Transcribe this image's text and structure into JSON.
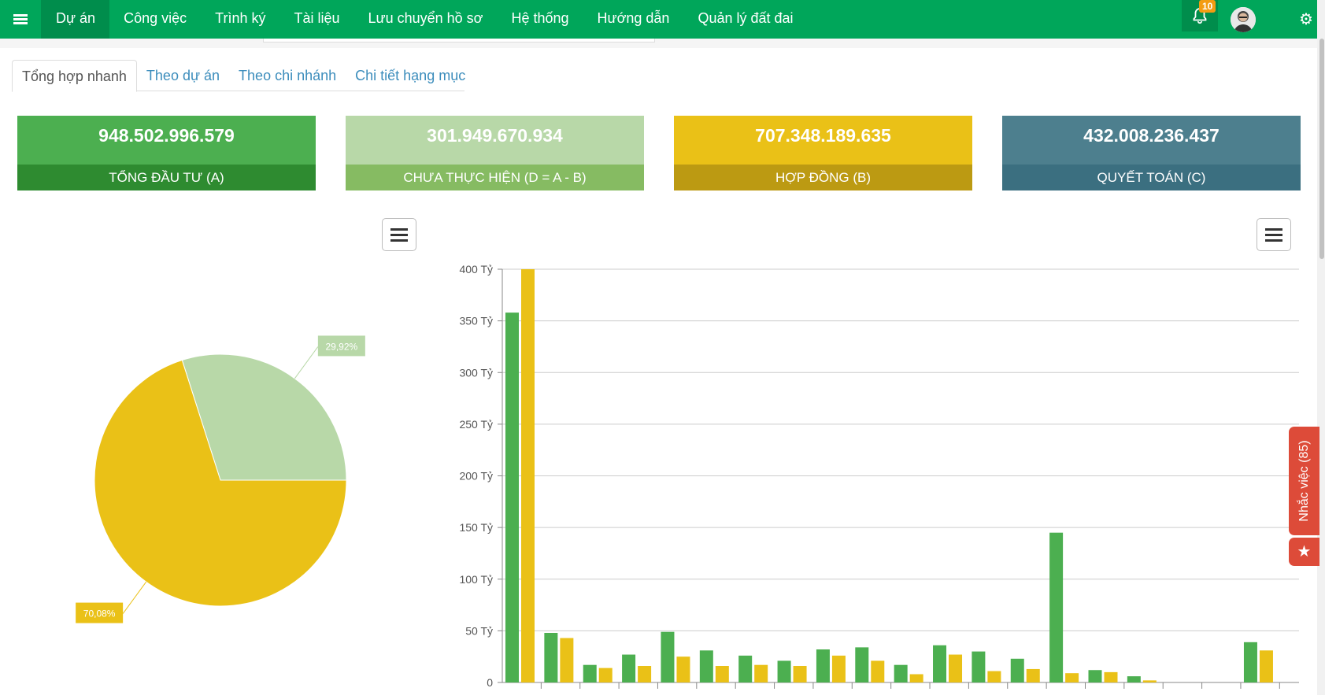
{
  "nav": {
    "items": [
      {
        "label": "Dự án",
        "active": true
      },
      {
        "label": "Công việc"
      },
      {
        "label": "Trình ký"
      },
      {
        "label": "Tài liệu"
      },
      {
        "label": "Lưu chuyển hồ sơ"
      },
      {
        "label": "Hệ thống"
      },
      {
        "label": "Hướng dẫn"
      },
      {
        "label": "Quản lý đất đai"
      }
    ],
    "notification_count": "10",
    "icons": [
      "menu-icon",
      "bell-icon",
      "avatar",
      "gears-icon"
    ]
  },
  "tabs": [
    {
      "label": "Tổng hợp nhanh",
      "active": true
    },
    {
      "label": "Theo dự án"
    },
    {
      "label": "Theo chi nhánh"
    },
    {
      "label": "Chi tiết hạng mục"
    }
  ],
  "stats": [
    {
      "value": "948.502.996.579",
      "label": "TỔNG ĐẦU TƯ (A)",
      "color_top": "#4caf50",
      "color_bottom": "#2e8b30"
    },
    {
      "value": "301.949.670.934",
      "label": "CHƯA THỰC HIỆN (D = A - B)",
      "color_top": "#b8d8a8",
      "color_bottom": "#86bb62"
    },
    {
      "value": "707.348.189.635",
      "label": "HỢP ĐỒNG (B)",
      "color_top": "#eac117",
      "color_bottom": "#bc9a12"
    },
    {
      "value": "432.008.236.437",
      "label": "QUYẾT TOÁN (C)",
      "color_top": "#4d7f8e",
      "color_bottom": "#3b6f80"
    }
  ],
  "chart_data": [
    {
      "type": "pie",
      "values": [
        29.92,
        70.08
      ],
      "labels": [
        "29,92%",
        "70,08%"
      ],
      "colors": [
        "#b8d8a8",
        "#eac117"
      ]
    },
    {
      "type": "bar",
      "ylim": [
        0,
        400
      ],
      "yticks": [
        "0",
        "50 Tỷ",
        "100 Tỷ",
        "150 Tỷ",
        "200 Tỷ",
        "250 Tỷ",
        "300 Tỷ",
        "350 Tỷ",
        "400 Tỷ"
      ],
      "categories_count": 20,
      "series": [
        {
          "color": "#4caf50",
          "values": [
            358,
            48,
            17,
            27,
            49,
            31,
            26,
            21,
            32,
            34,
            17,
            36,
            30,
            23,
            145,
            12,
            6,
            0,
            0,
            39
          ]
        },
        {
          "color": "#eac117",
          "values": [
            400,
            43,
            14,
            16,
            25,
            16,
            17,
            16,
            26,
            21,
            8,
            27,
            11,
            13,
            9,
            10,
            2,
            0,
            0,
            31
          ]
        }
      ],
      "grid": true
    }
  ],
  "side": {
    "reminder_label": "Nhắc việc (85)"
  }
}
